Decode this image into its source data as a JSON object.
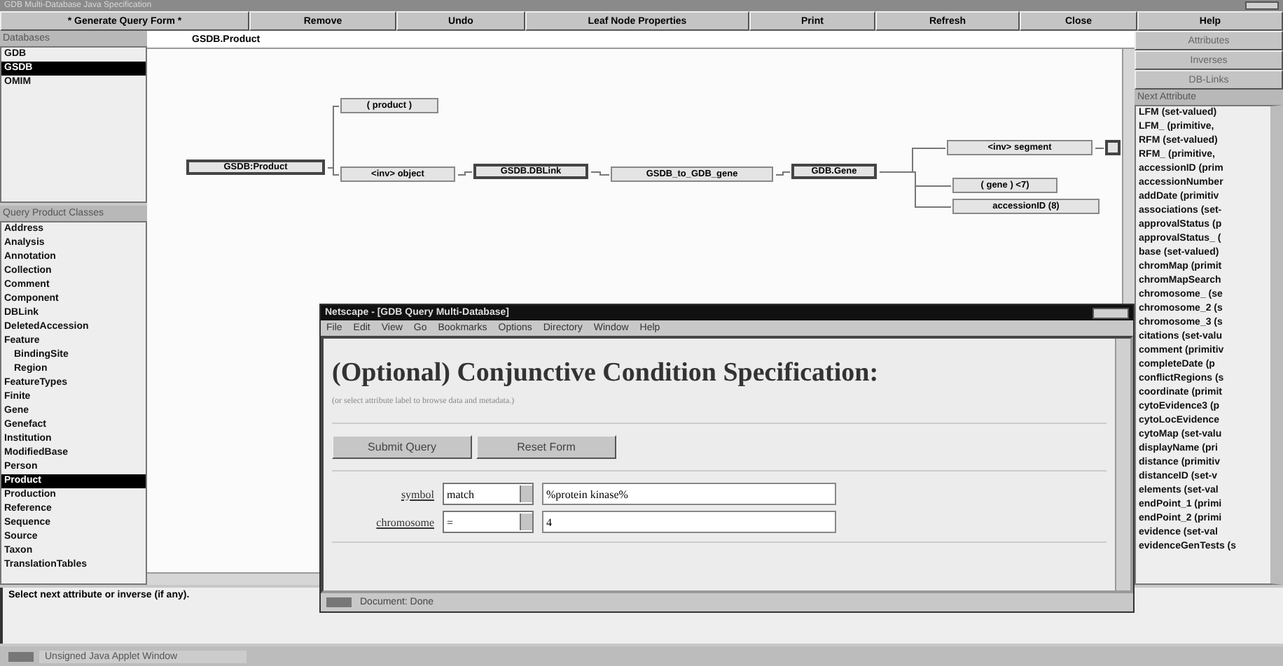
{
  "window": {
    "title": "GDB Multi-Database Java Specification"
  },
  "toolbar": [
    {
      "label": "* Generate Query Form *"
    },
    {
      "label": "Remove"
    },
    {
      "label": "Undo"
    },
    {
      "label": "Leaf Node Properties"
    },
    {
      "label": "Print"
    },
    {
      "label": "Refresh"
    },
    {
      "label": "Close"
    },
    {
      "label": "Help"
    }
  ],
  "databases": {
    "header": "Databases",
    "items": [
      {
        "label": "GDB",
        "selected": false
      },
      {
        "label": "GSDB",
        "selected": true
      },
      {
        "label": "OMIM",
        "selected": false
      }
    ]
  },
  "classes": {
    "header": "Query Product Classes",
    "items": [
      {
        "label": "Address",
        "selected": false
      },
      {
        "label": "Analysis",
        "selected": false
      },
      {
        "label": "Annotation",
        "selected": false
      },
      {
        "label": "Collection",
        "selected": false
      },
      {
        "label": "Comment",
        "selected": false
      },
      {
        "label": "Component",
        "selected": false
      },
      {
        "label": "DBLink",
        "selected": false
      },
      {
        "label": "DeletedAccession",
        "selected": false
      },
      {
        "label": "Feature",
        "selected": false,
        "children": [
          {
            "label": "BindingSite",
            "selected": false
          },
          {
            "label": "Region",
            "selected": false
          }
        ]
      },
      {
        "label": "FeatureTypes",
        "selected": false
      },
      {
        "label": "Finite",
        "selected": false
      },
      {
        "label": "Gene",
        "selected": false
      },
      {
        "label": "Genefact",
        "selected": false
      },
      {
        "label": "Institution",
        "selected": false
      },
      {
        "label": "ModifiedBase",
        "selected": false
      },
      {
        "label": "Person",
        "selected": false
      },
      {
        "label": "Product",
        "selected": true
      },
      {
        "label": "Production",
        "selected": false
      },
      {
        "label": "Reference",
        "selected": false
      },
      {
        "label": "Sequence",
        "selected": false
      },
      {
        "label": "Source",
        "selected": false
      },
      {
        "label": "Taxon",
        "selected": false
      },
      {
        "label": "TranslationTables",
        "selected": false
      }
    ]
  },
  "path": "GSDB.Product",
  "diagram": {
    "root": {
      "label": "GSDB:Product",
      "kind": "class",
      "children": [
        {
          "label": "( product )",
          "kind": "link"
        },
        {
          "label": "<inv> object",
          "kind": "link",
          "children": [
            {
              "label": "GSDB.DBLink",
              "kind": "class",
              "children": [
                {
                  "label": "GSDB_to_GDB_gene",
                  "kind": "link",
                  "children": [
                    {
                      "label": "GDB.Gene",
                      "kind": "class",
                      "children": [
                        {
                          "label": "<inv> segment",
                          "kind": "link",
                          "children": [
                            {
                              "kind": "class"
                            }
                          ]
                        },
                        {
                          "label": "( gene ) <7)",
                          "kind": "link"
                        },
                        {
                          "label": "accessionID (8)",
                          "kind": "link"
                        }
                      ]
                    }
                  ]
                }
              ]
            }
          ]
        }
      ]
    }
  },
  "side_buttons": [
    {
      "label": "Attributes"
    },
    {
      "label": "Inverses"
    },
    {
      "label": "DB-Links"
    }
  ],
  "attributes": {
    "header": "Next Attribute",
    "items": [
      "LFM (set-valued) ",
      "LFM_ (primitive, ",
      "RFM (set-valued)",
      "RFM_ (primitive, ",
      "accessionID (prim",
      "accessionNumber",
      "addDate (primitiv",
      "associations (set-",
      "approvalStatus (p",
      "approvalStatus_ (",
      "base (set-valued)",
      "chromMap (primit",
      "chromMapSearch",
      "chromosome_ (se",
      "chromosome_2 (s",
      "chromosome_3 (s",
      "citations (set-valu",
      "comment (primitiv",
      "completeDate (p",
      "conflictRegions (s",
      "coordinate (primit",
      "cytoEvidence3 (p",
      "cytoLocEvidence",
      "cytoMap (set-valu",
      "displayName (pri",
      "distance (primitiv",
      "distanceID (set-v",
      "elements (set-val",
      "endPoint_1 (primi",
      "endPoint_2 (primi",
      "evidence (set-val",
      "evidenceGenTests (s"
    ]
  },
  "browser": {
    "title": "Netscape - [GDB Query Multi-Database]",
    "menu": [
      "File",
      "Edit",
      "View",
      "Go",
      "Bookmarks",
      "Options",
      "Directory",
      "Window",
      "Help"
    ],
    "heading": "(Optional) Conjunctive Condition Specification:",
    "note": "(or select attribute label to browse data and metadata.)",
    "buttons": [
      "Submit Query",
      "Reset Form"
    ],
    "conditions": [
      {
        "attribute": "symbol",
        "operator": "match",
        "value": "%protein kinase%"
      },
      {
        "attribute": "chromosome",
        "operator": "=",
        "value": "4"
      }
    ],
    "status": "Document: Done"
  },
  "message": "Select next attribute or inverse (if any).",
  "taskbar": "Unsigned Java Applet Window"
}
